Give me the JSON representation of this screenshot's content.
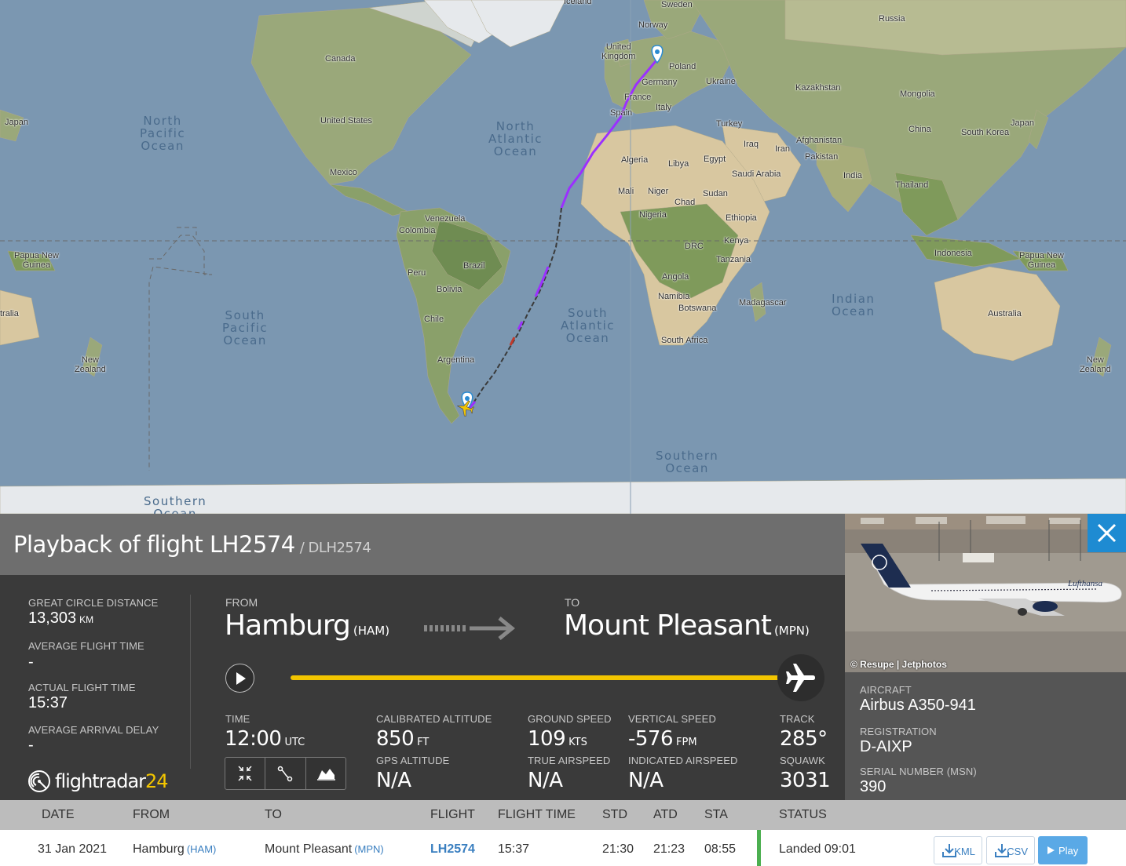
{
  "map": {
    "countries": [
      {
        "name": "Iceland"
      },
      {
        "name": "Sweden"
      },
      {
        "name": "Norway"
      },
      {
        "name": "Russia"
      },
      {
        "name": "United\nKingdom"
      },
      {
        "name": "Poland"
      },
      {
        "name": "Germany"
      },
      {
        "name": "Ukraine"
      },
      {
        "name": "France"
      },
      {
        "name": "Italy"
      },
      {
        "name": "Kazakhstan"
      },
      {
        "name": "Mongolia"
      },
      {
        "name": "Spain"
      },
      {
        "name": "Turkey"
      },
      {
        "name": "Iraq"
      },
      {
        "name": "Iran"
      },
      {
        "name": "Afghanistan"
      },
      {
        "name": "China"
      },
      {
        "name": "Japan"
      },
      {
        "name": "South Korea"
      },
      {
        "name": "Pakistan"
      },
      {
        "name": "Algeria"
      },
      {
        "name": "Libya"
      },
      {
        "name": "Egypt"
      },
      {
        "name": "Saudi Arabia"
      },
      {
        "name": "India"
      },
      {
        "name": "Thailand"
      },
      {
        "name": "Mali"
      },
      {
        "name": "Niger"
      },
      {
        "name": "Sudan"
      },
      {
        "name": "Chad"
      },
      {
        "name": "Nigeria"
      },
      {
        "name": "Ethiopia"
      },
      {
        "name": "Kenya"
      },
      {
        "name": "DRC"
      },
      {
        "name": "Tanzania"
      },
      {
        "name": "Indonesia"
      },
      {
        "name": "Papua New\nGuinea"
      },
      {
        "name": "Angola"
      },
      {
        "name": "Namibia"
      },
      {
        "name": "Botswana"
      },
      {
        "name": "Madagascar"
      },
      {
        "name": "South Africa"
      },
      {
        "name": "Australia"
      },
      {
        "name": "New\nZealand"
      },
      {
        "name": "Canada"
      },
      {
        "name": "United States"
      },
      {
        "name": "Mexico"
      },
      {
        "name": "Venezuela"
      },
      {
        "name": "Colombia"
      },
      {
        "name": "Peru"
      },
      {
        "name": "Brazil"
      },
      {
        "name": "Bolivia"
      },
      {
        "name": "Chile"
      },
      {
        "name": "Argentina"
      },
      {
        "name": "Japan"
      },
      {
        "name": "Papua New\nGuinea"
      },
      {
        "name": "tralia"
      },
      {
        "name": "New\nZealand"
      }
    ],
    "oceans": [
      {
        "name": "North\nPacific\nOcean"
      },
      {
        "name": "North\nAtlantic\nOcean"
      },
      {
        "name": "South\nPacific\nOcean"
      },
      {
        "name": "South\nAtlantic\nOcean"
      },
      {
        "name": "Indian\nOcean"
      },
      {
        "name": "Southern\nOcean"
      },
      {
        "name": "Southern\nOcean"
      }
    ],
    "track_color": "#9b30ff"
  },
  "header": {
    "title": "Playback of flight LH2574",
    "callsign": "/ DLH2574"
  },
  "stats": {
    "great_circle_label": "GREAT CIRCLE DISTANCE",
    "great_circle_value": "13,303",
    "great_circle_unit": "KM",
    "avg_flight_time_label": "AVERAGE FLIGHT TIME",
    "avg_flight_time_value": "-",
    "actual_flight_time_label": "ACTUAL FLIGHT TIME",
    "actual_flight_time_value": "15:37",
    "avg_arrival_delay_label": "AVERAGE ARRIVAL DELAY",
    "avg_arrival_delay_value": "-"
  },
  "route": {
    "from_label": "FROM",
    "from_city": "Hamburg",
    "from_code": "(HAM)",
    "to_label": "TO",
    "to_city": "Mount Pleasant",
    "to_code": "(MPN)",
    "progress": 1.0
  },
  "telemetry": {
    "time_label": "TIME",
    "time_value": "12:00",
    "time_unit": "UTC",
    "cal_alt_label": "CALIBRATED ALTITUDE",
    "cal_alt_value": "850",
    "cal_alt_unit": "FT",
    "gps_alt_label": "GPS ALTITUDE",
    "gps_alt_value": "N/A",
    "ground_speed_label": "GROUND SPEED",
    "ground_speed_value": "109",
    "ground_speed_unit": "KTS",
    "true_airspeed_label": "TRUE AIRSPEED",
    "true_airspeed_value": "N/A",
    "vertical_speed_label": "VERTICAL SPEED",
    "vertical_speed_value": "-576",
    "vertical_speed_unit": "FPM",
    "indicated_airspeed_label": "INDICATED AIRSPEED",
    "indicated_airspeed_value": "N/A",
    "track_label": "TRACK",
    "track_value": "285°",
    "squawk_label": "SQUAWK",
    "squawk_value": "3031"
  },
  "logo": {
    "text": "flightradar",
    "num": "24"
  },
  "aircraft": {
    "photo_credit": "© Resupe | Jetphotos",
    "aircraft_label": "AIRCRAFT",
    "aircraft_value": "Airbus A350-941",
    "registration_label": "REGISTRATION",
    "registration_value": "D-AIXP",
    "serial_label": "SERIAL NUMBER (MSN)",
    "serial_value": "390",
    "livery_text": "Lufthansa"
  },
  "table": {
    "headers": {
      "date": "DATE",
      "from": "FROM",
      "to": "TO",
      "flight": "FLIGHT",
      "flight_time": "FLIGHT TIME",
      "std": "STD",
      "atd": "ATD",
      "sta": "STA",
      "status": "STATUS"
    },
    "row": {
      "date": "31 Jan 2021",
      "from": "Hamburg",
      "from_code": "(HAM)",
      "to": "Mount Pleasant",
      "to_code": "(MPN)",
      "flight": "LH2574",
      "flight_time": "15:37",
      "std": "21:30",
      "atd": "21:23",
      "sta": "08:55",
      "status": "Landed 09:01",
      "kml_label": "KML",
      "csv_label": "CSV",
      "play_label": "Play"
    }
  }
}
